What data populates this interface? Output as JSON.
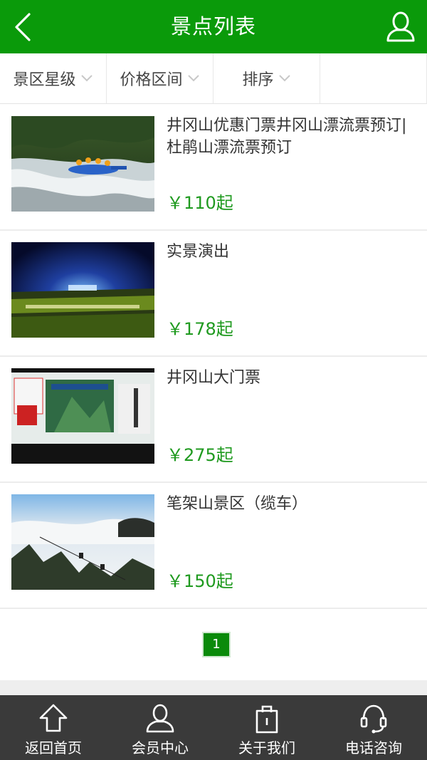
{
  "header": {
    "title": "景点列表",
    "back_icon": "chevron-left-icon",
    "user_icon": "user-icon"
  },
  "filters": [
    {
      "label": "景区星级"
    },
    {
      "label": "价格区间"
    },
    {
      "label": "排序"
    }
  ],
  "items": [
    {
      "name": "井冈山优惠门票井冈山漂流票预订|杜鹃山漂流票预订",
      "price": "￥110起",
      "image": "rafting-photo"
    },
    {
      "name": "实景演出",
      "price": "￥178起",
      "image": "night-show-photo"
    },
    {
      "name": "井冈山大门票",
      "price": "￥275起",
      "image": "ticket-photo"
    },
    {
      "name": "笔架山景区（缆车）",
      "price": "￥150起",
      "image": "cable-car-photo"
    }
  ],
  "pagination": {
    "current": "1"
  },
  "tabbar": [
    {
      "label": "返回首页",
      "icon": "home-icon"
    },
    {
      "label": "会员中心",
      "icon": "user-icon"
    },
    {
      "label": "关于我们",
      "icon": "bag-icon"
    },
    {
      "label": "电话咨询",
      "icon": "headset-icon"
    }
  ],
  "colors": {
    "primary": "#0a9a0a",
    "price": "#1f9a1f",
    "tabbar": "#3a3a3a"
  }
}
